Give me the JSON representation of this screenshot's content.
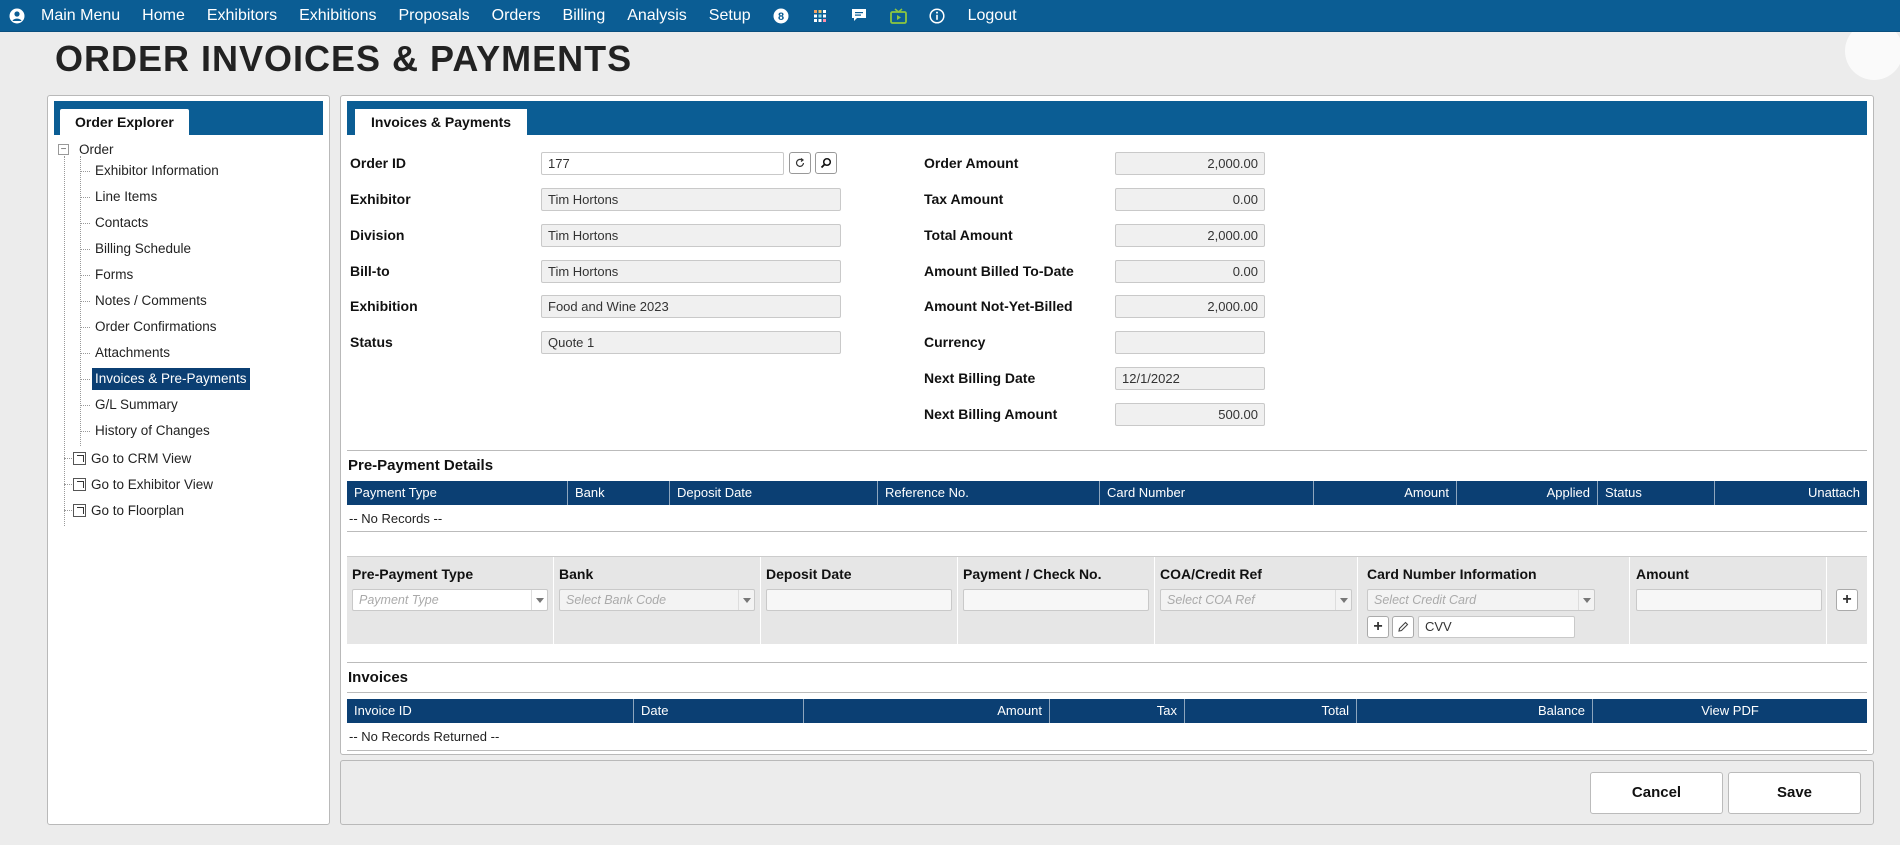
{
  "topbar": {
    "menu": [
      "Main Menu",
      "Home",
      "Exhibitors",
      "Exhibitions",
      "Proposals",
      "Orders",
      "Billing",
      "Analysis",
      "Setup"
    ],
    "icons": [
      "user-icon",
      "badge-icon",
      "grid-icon",
      "chat-icon",
      "tv-icon",
      "info-icon"
    ],
    "badge_text": "8",
    "logout": "Logout"
  },
  "page_title": "ORDER INVOICES & PAYMENTS",
  "explorer": {
    "tab": "Order Explorer",
    "root": "Order",
    "items": [
      "Exhibitor Information",
      "Line Items",
      "Contacts",
      "Billing Schedule",
      "Forms",
      "Notes / Comments",
      "Order Confirmations",
      "Attachments",
      "Invoices & Pre-Payments",
      "G/L Summary",
      "History of Changes"
    ],
    "selected": "Invoices & Pre-Payments",
    "goto": [
      "Go to CRM View",
      "Go to Exhibitor View",
      "Go to Floorplan"
    ]
  },
  "main": {
    "tab": "Invoices & Payments",
    "left_fields": {
      "order_id_label": "Order ID",
      "order_id": "177",
      "exhibitor_label": "Exhibitor",
      "exhibitor": "Tim Hortons",
      "division_label": "Division",
      "division": "Tim Hortons",
      "billto_label": "Bill-to",
      "billto": "Tim Hortons",
      "exhibition_label": "Exhibition",
      "exhibition": "Food and Wine 2023",
      "status_label": "Status",
      "status": "Quote 1"
    },
    "right_fields": {
      "order_amount_label": "Order Amount",
      "order_amount": "2,000.00",
      "tax_amount_label": "Tax Amount",
      "tax_amount": "0.00",
      "total_amount_label": "Total Amount",
      "total_amount": "2,000.00",
      "billed_label": "Amount Billed To-Date",
      "billed": "0.00",
      "not_billed_label": "Amount Not-Yet-Billed",
      "not_billed": "2,000.00",
      "currency_label": "Currency",
      "currency": "",
      "next_date_label": "Next Billing Date",
      "next_date": "12/1/2022",
      "next_amount_label": "Next Billing Amount",
      "next_amount": "500.00"
    },
    "prepayment": {
      "title": "Pre-Payment Details",
      "columns": [
        "Payment Type",
        "Bank",
        "Deposit Date",
        "Reference No.",
        "Card Number",
        "Amount",
        "Applied",
        "Status",
        "Unattach"
      ],
      "empty": "-- No Records --",
      "entry_labels": [
        "Pre-Payment Type",
        "Bank",
        "Deposit Date",
        "Payment / Check No.",
        "COA/Credit Ref",
        "Card Number Information",
        "Amount"
      ],
      "payment_type_placeholder": "Payment Type",
      "bank_placeholder": "Select Bank Code",
      "coa_placeholder": "Select COA Ref",
      "card_placeholder": "Select Credit Card",
      "cvv": "CVV"
    },
    "invoices": {
      "title": "Invoices",
      "columns": [
        "Invoice ID",
        "Date",
        "Amount",
        "Tax",
        "Total",
        "Balance",
        "View PDF"
      ],
      "empty": "-- No Records Returned --"
    }
  },
  "footer": {
    "cancel": "Cancel",
    "save": "Save"
  },
  "colors": {
    "topbar": "#0b5d94",
    "grid_header": "#0b3f73",
    "tv_icon": "#8dc63f"
  }
}
